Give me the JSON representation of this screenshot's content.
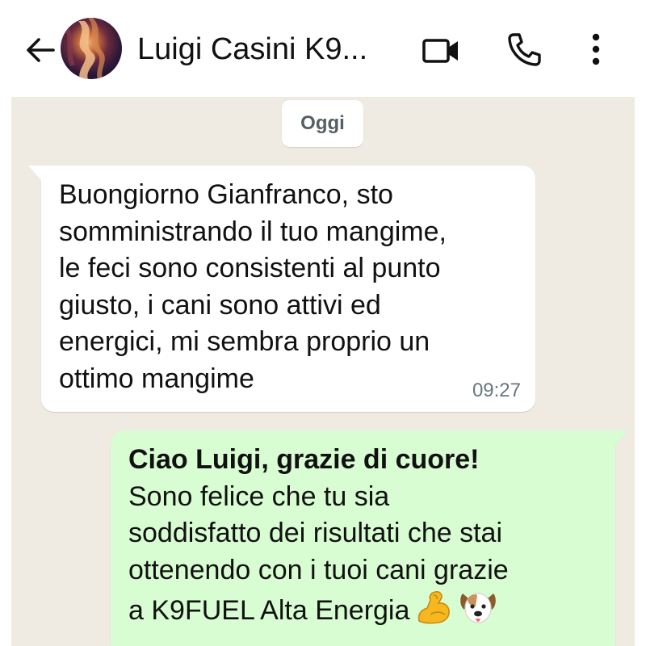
{
  "header": {
    "contact_name": "Luigi Casini K9...",
    "icons": {
      "back": "arrow-left-icon",
      "video": "video-camera-icon",
      "call": "phone-icon",
      "menu": "more-vertical-icon"
    }
  },
  "chat": {
    "date_chip": "Oggi",
    "messages": [
      {
        "direction": "incoming",
        "lines": [
          "Buongiorno Gianfranco, sto",
          "somministrando il tuo mangime,",
          "le feci sono consistenti al punto",
          "giusto, i cani sono attivi ed",
          "energici, mi sembra proprio un",
          "ottimo mangime"
        ],
        "time": "09:27"
      },
      {
        "direction": "outgoing",
        "title": "Ciao Luigi, grazie di cuore!",
        "lines": [
          "Sono felice che tu sia",
          "soddisfatto dei risultati che stai",
          "ottenendo con i tuoi cani grazie",
          "a K9FUEL Alta Energia"
        ],
        "emojis": [
          "flexed-biceps-emoji",
          "dog-face-emoji"
        ]
      }
    ]
  },
  "colors": {
    "chat_background": "#efeae2",
    "incoming_bubble": "#ffffff",
    "outgoing_bubble": "#d9fdd3",
    "timestamp": "#667781"
  }
}
